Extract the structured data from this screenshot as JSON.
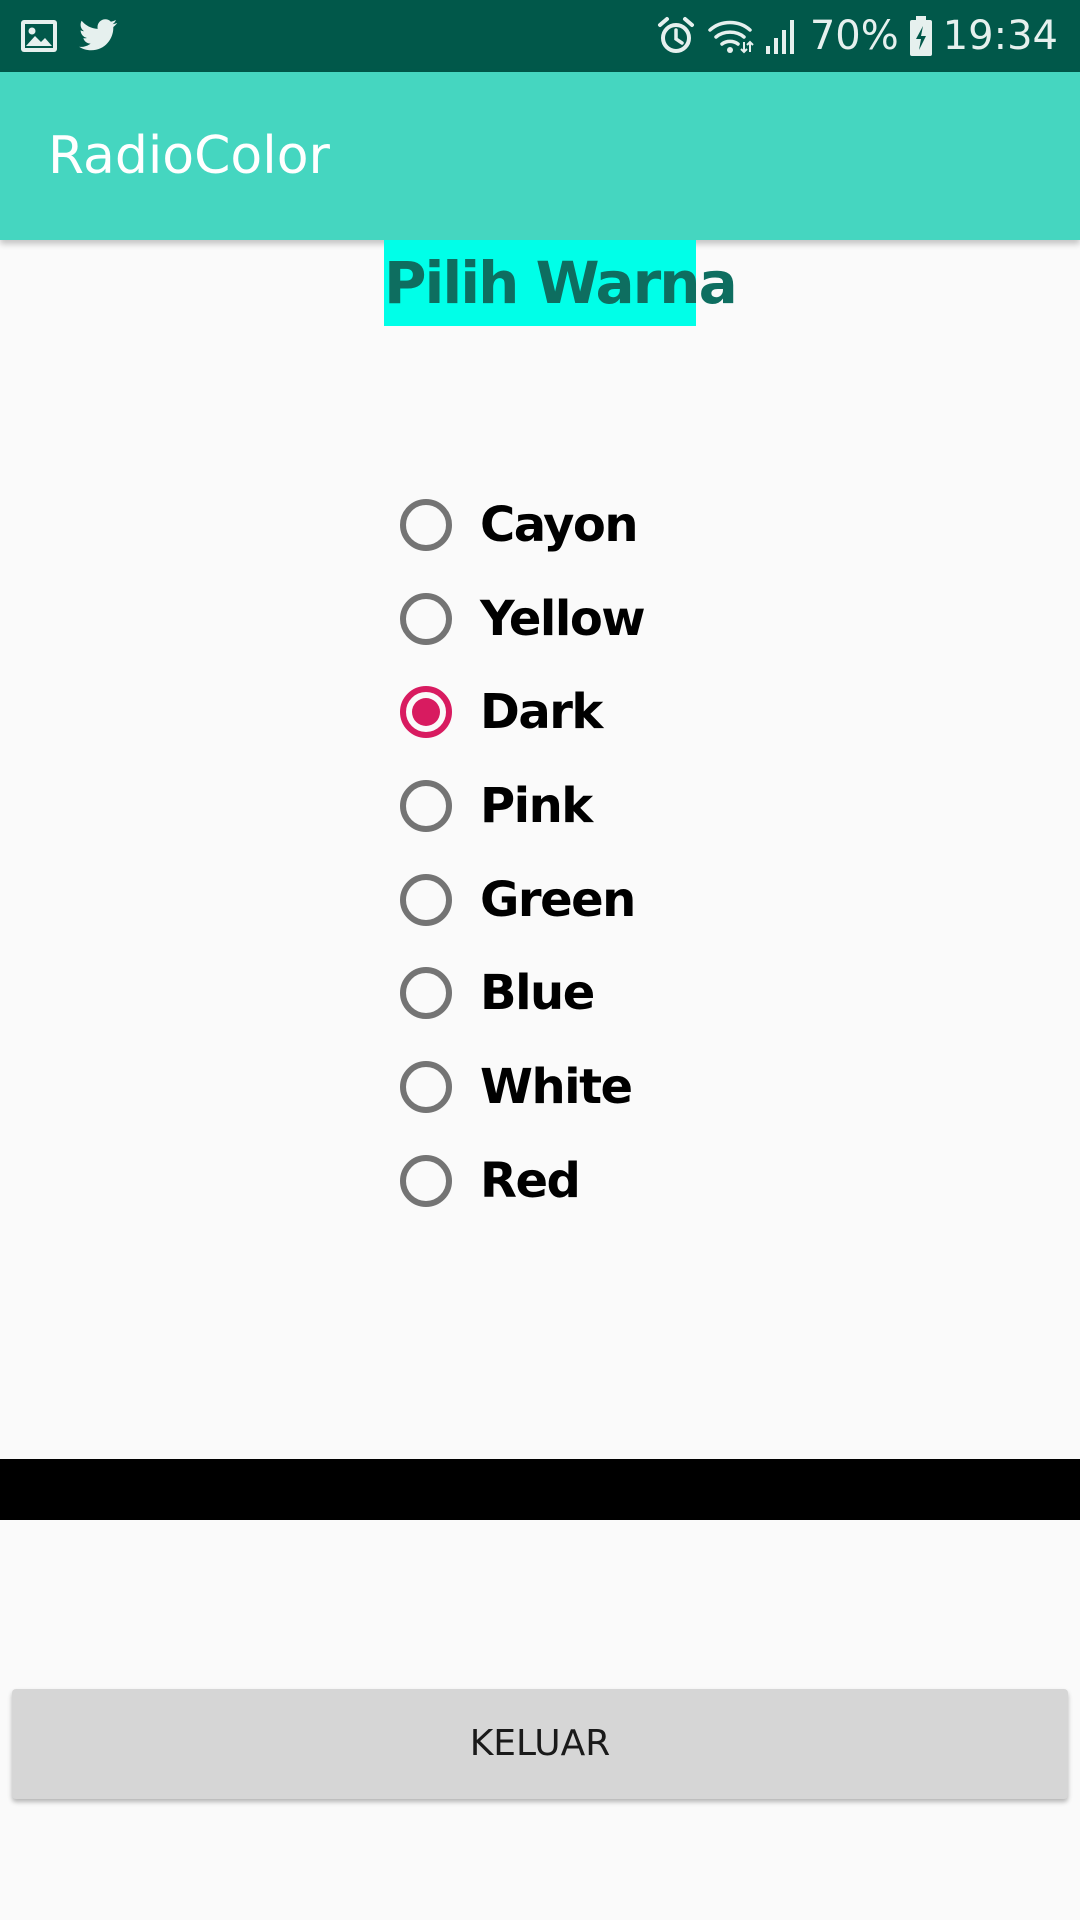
{
  "status_bar": {
    "battery": "70%",
    "time": "19:34",
    "left_icons": [
      "gallery-icon",
      "twitter-icon"
    ],
    "right_icons": [
      "alarm-icon",
      "wifi-icon",
      "signal-icon",
      "battery-icon"
    ]
  },
  "app_bar": {
    "title": "RadioColor",
    "color": "#45d6c0"
  },
  "heading": {
    "text": "Pilih Warna",
    "background": "#00ffe8",
    "color": "#0e6e60"
  },
  "radio_group": {
    "selected": "Dark",
    "accent": "#d81b60",
    "options": [
      {
        "label": "Cayon",
        "checked": false
      },
      {
        "label": "Yellow",
        "checked": false
      },
      {
        "label": "Dark",
        "checked": true
      },
      {
        "label": "Pink",
        "checked": false
      },
      {
        "label": "Green",
        "checked": false
      },
      {
        "label": "Blue",
        "checked": false
      },
      {
        "label": "White",
        "checked": false
      },
      {
        "label": "Red",
        "checked": false
      }
    ]
  },
  "button": {
    "label": "KELUAR"
  }
}
